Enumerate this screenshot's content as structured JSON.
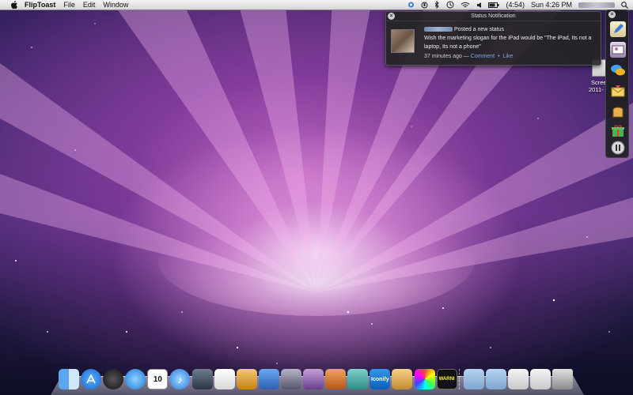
{
  "menubar": {
    "app_name": "FlipToast",
    "menus": [
      "File",
      "Edit",
      "Window"
    ],
    "battery_text": "(4:54)",
    "clock": "Sun 4:26 PM"
  },
  "notification": {
    "title": "Status Notification",
    "action": "Posted a new status",
    "message": "Wish the marketing slogan for the iPad would be \"The iPad, Its not a laptop, Its not a phone\"",
    "time": "37 minutes ago —",
    "comment_link": "Comment",
    "separator": "•",
    "like_link": "Like"
  },
  "desktop": {
    "screenshot_label_line1": "Scree",
    "screenshot_label_line2": "2011-"
  },
  "sidebar_icons": [
    "compose-icon",
    "photo-icon",
    "chat-bubbles-icon",
    "mail-icon",
    "toast-icon",
    "gift-icon",
    "pause-icon"
  ],
  "dock": {
    "apps": [
      "finder",
      "app-store",
      "dashboard",
      "safari",
      "ical",
      "itunes",
      "iphoto",
      "textedit",
      "preview",
      "xcode",
      "imovie",
      "dictionary",
      "fliptoast",
      "iconify",
      "toast",
      "colors",
      "console",
      "folder",
      "documents",
      "downloads",
      "mail-stack",
      "trash"
    ],
    "calendar_day": "10",
    "iconify_label": "Iconify",
    "console_label": "WARNI"
  },
  "colors": {
    "accent_link": "#7ea6e8",
    "notification_bg": "#242424",
    "menubar_top": "#f4f4f4"
  }
}
